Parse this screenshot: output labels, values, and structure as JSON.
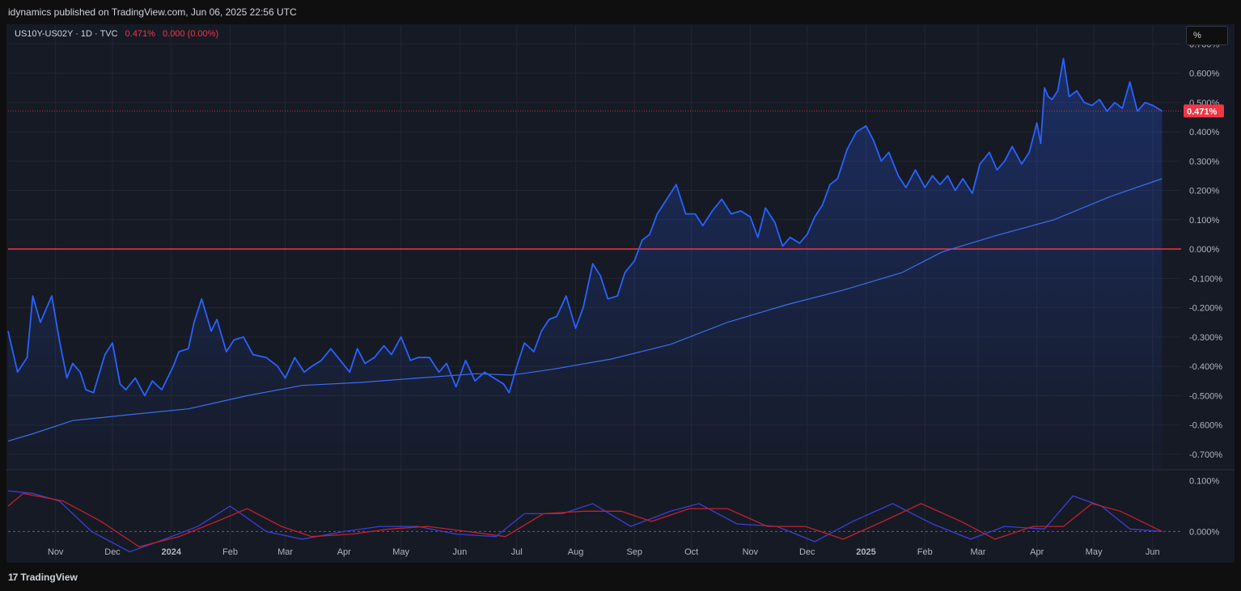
{
  "header": {
    "publish_text": "idynamics published on TradingView.com, Jun 06, 2025 22:56 UTC",
    "symbol": "US10Y-US02Y · 1D · TVC",
    "last_value": "0.471%",
    "change": "0.000 (0.00%)",
    "scale_button": "%"
  },
  "footer": {
    "logo_mark": "17",
    "logo_text": "TradingView"
  },
  "colors": {
    "background": "#161a25",
    "grid": "#232632",
    "price_line": "#2962ff",
    "ma_line": "#3d6df0",
    "zero_line": "#f23645",
    "macd_red": "#c2212b",
    "macd_blue": "#3b3fd6",
    "axis_text": "#b2b5be",
    "last_badge": "#f23645"
  },
  "chart_data": {
    "type": "line",
    "title": "",
    "y_axis": {
      "unit": "%",
      "ylim": [
        -0.75,
        0.72
      ],
      "tick_labels": [
        "0.700%",
        "0.600%",
        "0.500%",
        "0.400%",
        "0.300%",
        "0.200%",
        "0.100%",
        "0.000%",
        "-0.100%",
        "-0.200%",
        "-0.300%",
        "-0.400%",
        "-0.500%",
        "-0.600%",
        "-0.700%"
      ],
      "tick_values": [
        0.7,
        0.6,
        0.5,
        0.4,
        0.3,
        0.2,
        0.1,
        0.0,
        -0.1,
        -0.2,
        -0.3,
        -0.4,
        -0.5,
        -0.6,
        -0.7
      ]
    },
    "x_axis": {
      "tick_labels": [
        "Nov",
        "Dec",
        "2024",
        "Feb",
        "Mar",
        "Apr",
        "May",
        "Jun",
        "Jul",
        "Aug",
        "Sep",
        "Oct",
        "Nov",
        "Dec",
        "2025",
        "Feb",
        "Mar",
        "Apr",
        "May",
        "Jun"
      ],
      "tick_dates": [
        "2023-11-01",
        "2023-12-01",
        "2024-01-01",
        "2024-02-01",
        "2024-03-01",
        "2024-04-01",
        "2024-05-01",
        "2024-06-01",
        "2024-07-01",
        "2024-08-01",
        "2024-09-01",
        "2024-10-01",
        "2024-11-01",
        "2024-12-01",
        "2025-01-01",
        "2025-02-01",
        "2025-03-01",
        "2025-04-01",
        "2025-05-01",
        "2025-06-01"
      ],
      "range": [
        "2023-10-07",
        "2025-06-16"
      ]
    },
    "grid": true,
    "last_value": 0.471,
    "zero_line": 0.0,
    "series": [
      {
        "name": "US10Y-US02Y",
        "x": [
          "2023-10-07",
          "2023-10-12",
          "2023-10-17",
          "2023-10-20",
          "2023-10-24",
          "2023-10-30",
          "2023-11-03",
          "2023-11-07",
          "2023-11-10",
          "2023-11-14",
          "2023-11-17",
          "2023-11-21",
          "2023-11-27",
          "2023-12-01",
          "2023-12-05",
          "2023-12-08",
          "2023-12-13",
          "2023-12-18",
          "2023-12-22",
          "2023-12-27",
          "2024-01-02",
          "2024-01-05",
          "2024-01-10",
          "2024-01-13",
          "2024-01-17",
          "2024-01-22",
          "2024-01-25",
          "2024-01-30",
          "2024-02-03",
          "2024-02-08",
          "2024-02-13",
          "2024-02-20",
          "2024-02-26",
          "2024-03-01",
          "2024-03-06",
          "2024-03-11",
          "2024-03-15",
          "2024-03-20",
          "2024-03-25",
          "2024-03-30",
          "2024-04-04",
          "2024-04-08",
          "2024-04-12",
          "2024-04-17",
          "2024-04-22",
          "2024-04-26",
          "2024-05-01",
          "2024-05-06",
          "2024-05-10",
          "2024-05-16",
          "2024-05-21",
          "2024-05-25",
          "2024-05-30",
          "2024-06-04",
          "2024-06-09",
          "2024-06-14",
          "2024-06-19",
          "2024-06-24",
          "2024-06-27",
          "2024-07-01",
          "2024-07-05",
          "2024-07-10",
          "2024-07-14",
          "2024-07-18",
          "2024-07-22",
          "2024-07-27",
          "2024-08-01",
          "2024-08-05",
          "2024-08-07",
          "2024-08-10",
          "2024-08-14",
          "2024-08-18",
          "2024-08-23",
          "2024-08-27",
          "2024-09-01",
          "2024-09-05",
          "2024-09-09",
          "2024-09-13",
          "2024-09-18",
          "2024-09-23",
          "2024-09-28",
          "2024-10-03",
          "2024-10-07",
          "2024-10-12",
          "2024-10-17",
          "2024-10-22",
          "2024-10-27",
          "2024-11-01",
          "2024-11-05",
          "2024-11-09",
          "2024-11-14",
          "2024-11-18",
          "2024-11-22",
          "2024-11-27",
          "2024-12-01",
          "2024-12-05",
          "2024-12-09",
          "2024-12-13",
          "2024-12-17",
          "2024-12-22",
          "2024-12-27",
          "2025-01-01",
          "2025-01-05",
          "2025-01-09",
          "2025-01-13",
          "2025-01-18",
          "2025-01-22",
          "2025-01-27",
          "2025-02-01",
          "2025-02-05",
          "2025-02-09",
          "2025-02-13",
          "2025-02-17",
          "2025-02-21",
          "2025-02-26",
          "2025-03-02",
          "2025-03-07",
          "2025-03-11",
          "2025-03-15",
          "2025-03-19",
          "2025-03-24",
          "2025-03-28",
          "2025-04-01",
          "2025-04-03",
          "2025-04-05",
          "2025-04-07",
          "2025-04-09",
          "2025-04-12",
          "2025-04-15",
          "2025-04-18",
          "2025-04-22",
          "2025-04-26",
          "2025-04-30",
          "2025-05-04",
          "2025-05-08",
          "2025-05-12",
          "2025-05-16",
          "2025-05-20",
          "2025-05-24",
          "2025-05-28",
          "2025-06-01",
          "2025-06-06"
        ],
        "values": [
          -0.28,
          -0.42,
          -0.37,
          -0.16,
          -0.25,
          -0.16,
          -0.31,
          -0.44,
          -0.39,
          -0.42,
          -0.48,
          -0.49,
          -0.36,
          -0.32,
          -0.46,
          -0.48,
          -0.44,
          -0.5,
          -0.45,
          -0.48,
          -0.4,
          -0.35,
          -0.34,
          -0.25,
          -0.17,
          -0.28,
          -0.24,
          -0.35,
          -0.31,
          -0.3,
          -0.36,
          -0.37,
          -0.4,
          -0.44,
          -0.37,
          -0.42,
          -0.4,
          -0.38,
          -0.34,
          -0.38,
          -0.42,
          -0.34,
          -0.39,
          -0.37,
          -0.33,
          -0.36,
          -0.3,
          -0.38,
          -0.37,
          -0.37,
          -0.42,
          -0.39,
          -0.47,
          -0.38,
          -0.45,
          -0.42,
          -0.44,
          -0.46,
          -0.49,
          -0.4,
          -0.32,
          -0.35,
          -0.28,
          -0.24,
          -0.23,
          -0.16,
          -0.27,
          -0.2,
          -0.14,
          -0.05,
          -0.09,
          -0.17,
          -0.16,
          -0.08,
          -0.04,
          0.03,
          0.05,
          0.12,
          0.17,
          0.22,
          0.12,
          0.12,
          0.08,
          0.13,
          0.17,
          0.12,
          0.13,
          0.11,
          0.04,
          0.14,
          0.09,
          0.01,
          0.04,
          0.02,
          0.05,
          0.11,
          0.15,
          0.22,
          0.24,
          0.34,
          0.4,
          0.42,
          0.37,
          0.3,
          0.33,
          0.25,
          0.21,
          0.27,
          0.21,
          0.25,
          0.22,
          0.25,
          0.2,
          0.24,
          0.19,
          0.29,
          0.33,
          0.27,
          0.3,
          0.35,
          0.29,
          0.33,
          0.43,
          0.36,
          0.55,
          0.52,
          0.51,
          0.54,
          0.65,
          0.52,
          0.54,
          0.5,
          0.49,
          0.51,
          0.47,
          0.5,
          0.48,
          0.57,
          0.47,
          0.5,
          0.49,
          0.471
        ]
      },
      {
        "name": "",
        "x": [
          "2023-10-07",
          "2023-10-20",
          "2023-11-10",
          "2023-12-10",
          "2024-01-10",
          "2024-02-10",
          "2024-03-10",
          "2024-04-10",
          "2024-05-10",
          "2024-06-10",
          "2024-06-28",
          "2024-07-20",
          "2024-08-20",
          "2024-09-20",
          "2024-10-20",
          "2024-11-20",
          "2024-12-20",
          "2025-01-20",
          "2025-02-10",
          "2025-03-10",
          "2025-04-10",
          "2025-05-10",
          "2025-06-06"
        ],
        "values": [
          -0.655,
          -0.63,
          -0.585,
          -0.565,
          -0.545,
          -0.5,
          -0.465,
          -0.455,
          -0.44,
          -0.425,
          -0.43,
          -0.41,
          -0.375,
          -0.325,
          -0.25,
          -0.19,
          -0.14,
          -0.08,
          -0.01,
          0.045,
          0.1,
          0.18,
          0.24
        ]
      }
    ],
    "oscillator": {
      "y_axis": {
        "tick_labels": [
          "0.100%",
          "0.000%"
        ],
        "tick_values": [
          0.1,
          0.0
        ],
        "ylim": [
          -0.055,
          0.12
        ]
      },
      "series": [
        {
          "name": "",
          "x": [
            "2023-10-07",
            "2023-10-20",
            "2023-11-03",
            "2023-11-20",
            "2023-12-10",
            "2023-12-25",
            "2024-01-15",
            "2024-02-01",
            "2024-02-20",
            "2024-03-10",
            "2024-04-01",
            "2024-04-20",
            "2024-05-10",
            "2024-05-30",
            "2024-06-20",
            "2024-07-05",
            "2024-07-25",
            "2024-08-10",
            "2024-08-30",
            "2024-09-20",
            "2024-10-05",
            "2024-10-25",
            "2024-11-15",
            "2024-12-05",
            "2024-12-25",
            "2025-01-15",
            "2025-02-05",
            "2025-02-25",
            "2025-03-15",
            "2025-04-05",
            "2025-04-20",
            "2025-05-05",
            "2025-05-20",
            "2025-06-06"
          ],
          "values": [
            0.08,
            0.075,
            0.06,
            0.0,
            -0.04,
            -0.02,
            0.01,
            0.05,
            0.0,
            -0.015,
            0.0,
            0.01,
            0.01,
            -0.005,
            -0.01,
            0.035,
            0.035,
            0.055,
            0.01,
            0.04,
            0.055,
            0.015,
            0.01,
            -0.02,
            0.02,
            0.055,
            0.015,
            -0.015,
            0.01,
            0.005,
            0.07,
            0.05,
            0.005,
            0.0
          ]
        },
        {
          "name": "",
          "x": [
            "2023-10-07",
            "2023-10-15",
            "2023-11-05",
            "2023-11-25",
            "2023-12-15",
            "2024-01-05",
            "2024-01-25",
            "2024-02-10",
            "2024-02-28",
            "2024-03-15",
            "2024-04-05",
            "2024-04-25",
            "2024-05-15",
            "2024-06-05",
            "2024-06-25",
            "2024-07-15",
            "2024-08-05",
            "2024-08-25",
            "2024-09-10",
            "2024-09-30",
            "2024-10-20",
            "2024-11-10",
            "2024-11-30",
            "2024-12-20",
            "2025-01-10",
            "2025-01-30",
            "2025-02-20",
            "2025-03-10",
            "2025-03-30",
            "2025-04-15",
            "2025-04-30",
            "2025-05-15",
            "2025-06-06"
          ],
          "values": [
            0.05,
            0.075,
            0.06,
            0.02,
            -0.03,
            -0.01,
            0.02,
            0.045,
            0.01,
            -0.01,
            -0.005,
            0.005,
            0.01,
            0.0,
            -0.01,
            0.035,
            0.04,
            0.04,
            0.02,
            0.045,
            0.045,
            0.01,
            0.01,
            -0.015,
            0.02,
            0.055,
            0.02,
            -0.015,
            0.01,
            0.01,
            0.055,
            0.04,
            0.0
          ]
        }
      ]
    }
  }
}
